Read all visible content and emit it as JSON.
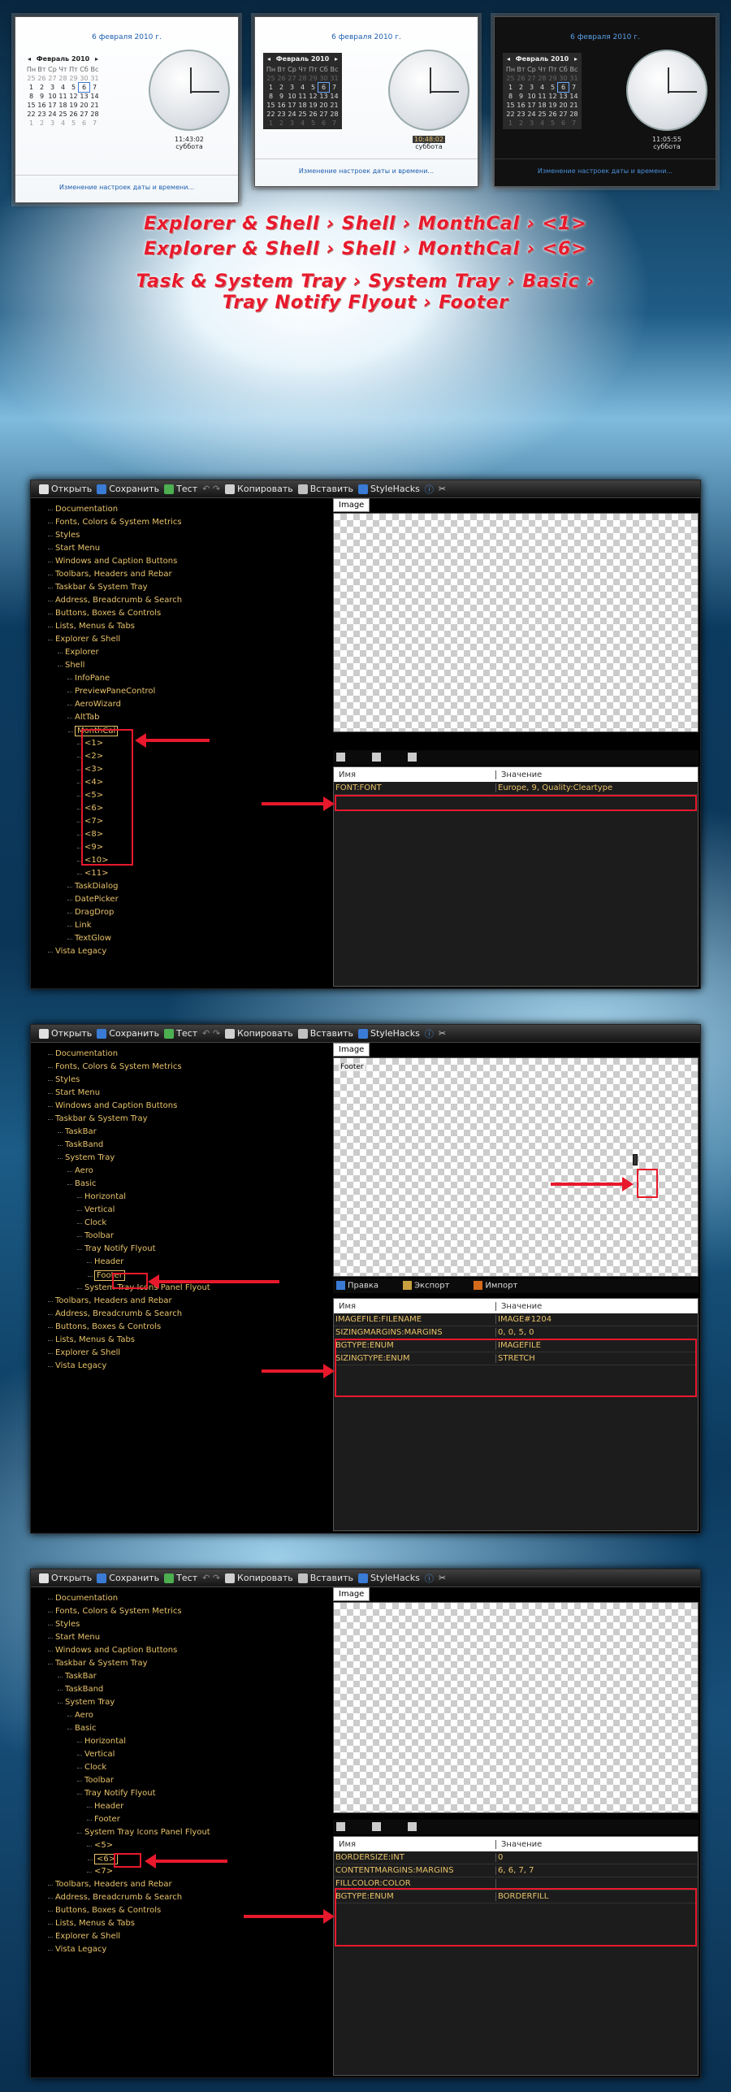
{
  "calendar_windows": [
    {
      "theme": "light",
      "date_title": "6 февраля 2010 г.",
      "month": "Февраль 2010",
      "time": "11:43:02",
      "day": "суббота",
      "footer": "Изменение настроек даты и времени..."
    },
    {
      "theme": "white-dark-cal",
      "date_title": "6 февраля 2010 г.",
      "month": "Февраль 2010",
      "time": "10:48:02",
      "day": "суббота",
      "footer": "Изменение настроек даты и времени..."
    },
    {
      "theme": "dark",
      "date_title": "6 февраля 2010 г.",
      "month": "Февраль 2010",
      "time": "11:05:55",
      "day": "суббота",
      "footer": "Изменение настроек даты и времени..."
    }
  ],
  "calendar": {
    "days_header": [
      "Пн",
      "Вт",
      "Ср",
      "Чт",
      "Пт",
      "Сб",
      "Вс"
    ],
    "weeks": [
      [
        "25",
        "26",
        "27",
        "28",
        "29",
        "30",
        "31"
      ],
      [
        "1",
        "2",
        "3",
        "4",
        "5",
        "6",
        "7"
      ],
      [
        "8",
        "9",
        "10",
        "11",
        "12",
        "13",
        "14"
      ],
      [
        "15",
        "16",
        "17",
        "18",
        "19",
        "20",
        "21"
      ],
      [
        "22",
        "23",
        "24",
        "25",
        "26",
        "27",
        "28"
      ],
      [
        "1",
        "2",
        "3",
        "4",
        "5",
        "6",
        "7"
      ]
    ],
    "today": "6"
  },
  "banner": [
    "Explorer & Shell › Shell › MonthCal › <1>",
    "Explorer & Shell › Shell › MonthCal › <6>",
    "Task & System Tray › System Tray › Basic ›",
    "Tray Notify Flyout › Footer"
  ],
  "toolbar": {
    "open": "Открыть",
    "save": "Сохранить",
    "test": "Тест",
    "copy": "Копировать",
    "insert": "Вставить",
    "stylehacks": "StyleHacks"
  },
  "image_tab": "Image",
  "props_toolbar": {
    "edit": "Правка",
    "export": "Экспорт",
    "import": "Импорт"
  },
  "grid_headers": {
    "name": "Имя",
    "value": "Значение"
  },
  "panel1": {
    "tree": [
      {
        "t": "Documentation",
        "i": 0
      },
      {
        "t": "Fonts, Colors & System Metrics",
        "i": 0
      },
      {
        "t": "Styles",
        "i": 0
      },
      {
        "t": "Start Menu",
        "i": 0
      },
      {
        "t": "Windows and Caption Buttons",
        "i": 0
      },
      {
        "t": "Toolbars, Headers and Rebar",
        "i": 0
      },
      {
        "t": "Taskbar & System Tray",
        "i": 0
      },
      {
        "t": "Address, Breadcrumb & Search",
        "i": 0
      },
      {
        "t": "Buttons, Boxes & Controls",
        "i": 0
      },
      {
        "t": "Lists, Menus & Tabs",
        "i": 0
      },
      {
        "t": "Explorer & Shell",
        "i": 0
      },
      {
        "t": "Explorer",
        "i": 1
      },
      {
        "t": "Shell",
        "i": 1
      },
      {
        "t": "InfoPane",
        "i": 2
      },
      {
        "t": "PreviewPaneControl",
        "i": 2
      },
      {
        "t": "AeroWizard",
        "i": 2
      },
      {
        "t": "AltTab",
        "i": 2
      },
      {
        "t": "MonthCal",
        "i": 2
      },
      {
        "t": "<1>",
        "i": 3
      },
      {
        "t": "<2>",
        "i": 3
      },
      {
        "t": "<3>",
        "i": 3
      },
      {
        "t": "<4>",
        "i": 3
      },
      {
        "t": "<5>",
        "i": 3
      },
      {
        "t": "<6>",
        "i": 3
      },
      {
        "t": "<7>",
        "i": 3
      },
      {
        "t": "<8>",
        "i": 3
      },
      {
        "t": "<9>",
        "i": 3
      },
      {
        "t": "<10>",
        "i": 3
      },
      {
        "t": "<11>",
        "i": 3
      },
      {
        "t": "TaskDialog",
        "i": 2
      },
      {
        "t": "DatePicker",
        "i": 2
      },
      {
        "t": "DragDrop",
        "i": 2
      },
      {
        "t": "Link",
        "i": 2
      },
      {
        "t": "TextGlow",
        "i": 2
      },
      {
        "t": "Vista Legacy",
        "i": 0
      }
    ],
    "rows": [
      {
        "name": "FONT:FONT",
        "value": "Europe, 9, Quality:Cleartype"
      }
    ]
  },
  "panel2": {
    "image_label": "Footer",
    "tree": [
      {
        "t": "Documentation",
        "i": 0
      },
      {
        "t": "Fonts, Colors & System Metrics",
        "i": 0
      },
      {
        "t": "Styles",
        "i": 0
      },
      {
        "t": "Start Menu",
        "i": 0
      },
      {
        "t": "Windows and Caption Buttons",
        "i": 0
      },
      {
        "t": "Taskbar & System Tray",
        "i": 0
      },
      {
        "t": "TaskBar",
        "i": 1
      },
      {
        "t": "TaskBand",
        "i": 1
      },
      {
        "t": "System Tray",
        "i": 1
      },
      {
        "t": "Aero",
        "i": 2
      },
      {
        "t": "Basic",
        "i": 2
      },
      {
        "t": "Horizontal",
        "i": 3
      },
      {
        "t": "Vertical",
        "i": 3
      },
      {
        "t": "Clock",
        "i": 3
      },
      {
        "t": "Toolbar",
        "i": 3
      },
      {
        "t": "Tray Notify Flyout",
        "i": 3
      },
      {
        "t": "Header",
        "i": 4
      },
      {
        "t": "Footer",
        "i": 4
      },
      {
        "t": "System Tray Icons Panel Flyout",
        "i": 3
      },
      {
        "t": "Toolbars, Headers and Rebar",
        "i": 0
      },
      {
        "t": "Address, Breadcrumb & Search",
        "i": 0
      },
      {
        "t": "Buttons, Boxes & Controls",
        "i": 0
      },
      {
        "t": "Lists, Menus & Tabs",
        "i": 0
      },
      {
        "t": "Explorer & Shell",
        "i": 0
      },
      {
        "t": "Vista Legacy",
        "i": 0
      }
    ],
    "rows": [
      {
        "name": "IMAGEFILE:FILENAME",
        "value": "IMAGE#1204"
      },
      {
        "name": "SIZINGMARGINS:MARGINS",
        "value": "0, 0, 5, 0"
      },
      {
        "name": "BGTYPE:ENUM",
        "value": "IMAGEFILE"
      },
      {
        "name": "SIZINGTYPE:ENUM",
        "value": "STRETCH"
      }
    ]
  },
  "panel3": {
    "tree": [
      {
        "t": "Documentation",
        "i": 0
      },
      {
        "t": "Fonts, Colors & System Metrics",
        "i": 0
      },
      {
        "t": "Styles",
        "i": 0
      },
      {
        "t": "Start Menu",
        "i": 0
      },
      {
        "t": "Windows and Caption Buttons",
        "i": 0
      },
      {
        "t": "Taskbar & System Tray",
        "i": 0
      },
      {
        "t": "TaskBar",
        "i": 1
      },
      {
        "t": "TaskBand",
        "i": 1
      },
      {
        "t": "System Tray",
        "i": 1
      },
      {
        "t": "Aero",
        "i": 2
      },
      {
        "t": "Basic",
        "i": 2
      },
      {
        "t": "Horizontal",
        "i": 3
      },
      {
        "t": "Vertical",
        "i": 3
      },
      {
        "t": "Clock",
        "i": 3
      },
      {
        "t": "Toolbar",
        "i": 3
      },
      {
        "t": "Tray Notify Flyout",
        "i": 3
      },
      {
        "t": "Header",
        "i": 4
      },
      {
        "t": "Footer",
        "i": 4
      },
      {
        "t": "System Tray Icons Panel Flyout",
        "i": 3
      },
      {
        "t": "<5>",
        "i": 4
      },
      {
        "t": "<6>",
        "i": 4
      },
      {
        "t": "<7>",
        "i": 4
      },
      {
        "t": "Toolbars, Headers and Rebar",
        "i": 0
      },
      {
        "t": "Address, Breadcrumb & Search",
        "i": 0
      },
      {
        "t": "Buttons, Boxes & Controls",
        "i": 0
      },
      {
        "t": "Lists, Menus & Tabs",
        "i": 0
      },
      {
        "t": "Explorer & Shell",
        "i": 0
      },
      {
        "t": "Vista Legacy",
        "i": 0
      }
    ],
    "rows": [
      {
        "name": "BORDERSIZE:INT",
        "value": "0"
      },
      {
        "name": "CONTENTMARGINS:MARGINS",
        "value": "6, 6, 7, 7"
      },
      {
        "name": "FILLCOLOR:COLOR",
        "value": ""
      },
      {
        "name": "BGTYPE:ENUM",
        "value": "BORDERFILL"
      }
    ]
  },
  "colors": {
    "accent_red": "#e8192c",
    "tree_text": "#e8c26a",
    "link_blue": "#1d5fb0"
  }
}
